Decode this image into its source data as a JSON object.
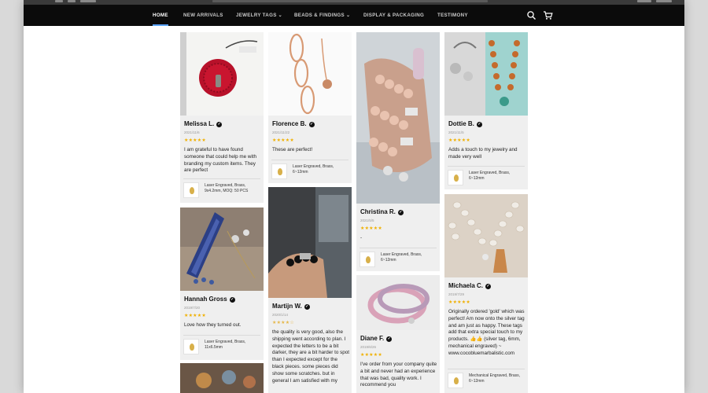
{
  "nav": {
    "items": [
      {
        "label": "HOME",
        "active": true
      },
      {
        "label": "NEW ARRIVALS",
        "active": false
      },
      {
        "label": "JEWELRY TAGS",
        "active": false,
        "dropdown": true
      },
      {
        "label": "BEADS & FINDINGS",
        "active": false,
        "dropdown": true
      },
      {
        "label": "DISPLAY & PACKAGING",
        "active": false
      },
      {
        "label": "TESTIMONY",
        "active": false
      }
    ],
    "search_icon": "search-icon",
    "cart_icon": "cart-icon",
    "dropdown_glyph": "⌄"
  },
  "reviews": {
    "verified_glyph": "✓",
    "star_full": "★★★★★",
    "star_partial": "★★★★☆",
    "cards": [
      {
        "id": "melissa",
        "name": "Melissa L.",
        "date": "2021/11/6",
        "rating": 5,
        "text": "I am grateful to have found someone that could help me with branding my custom items. They are perfect",
        "product": "Laser Engraved, Brass, 9x4.2mm, MOQ: 50 PCS"
      },
      {
        "id": "florence",
        "name": "Florence B.",
        "date": "2021/11/22",
        "rating": 5,
        "text": "These are perfect!",
        "product": "Laser Engraved, Brass, 6~12mm"
      },
      {
        "id": "christina",
        "name": "Christina R.",
        "date": "2021/5/5",
        "rating": 5,
        "text": "-",
        "product": "Laser Engraved, Brass, 6~12mm"
      },
      {
        "id": "dottie",
        "name": "Dottie B.",
        "date": "2021/11/5",
        "rating": 5,
        "text": "Adds a touch to my jewelry and made very well",
        "product": "Laser Engraved, Brass, 6~12mm"
      },
      {
        "id": "hannah",
        "name": "Hannah Gross",
        "date": "2019/7/20",
        "rating": 5,
        "text": "Love how they turned out.",
        "product": "Laser Engraved, Brass, 11x6.5mm"
      },
      {
        "id": "martijn",
        "name": "Martijn W.",
        "date": "2020/1/14",
        "rating": 4,
        "text": "the quality is very good, also the shipping went according to plan. I expected the letters to be a bit darker, they are a bit harder to spot than I expected except for the black pieces. some pieces did show some scratches. but in general I am satisfied with my",
        "product": ""
      },
      {
        "id": "diane",
        "name": "Diane F.",
        "date": "2019/6/26",
        "rating": 5,
        "text": "I've order from your company quite a bit and never had an experience that was bad, quality work. I recommend you",
        "product": ""
      },
      {
        "id": "michaela",
        "name": "Michaela C.",
        "date": "2019/7/29",
        "rating": 5,
        "text": "Originally ordered 'gold' which was perfect! Am now onto the silver tag and am just as happy. These tags add that extra special touch to my products. 👍👍 (silver tag, 6mm, mechanical engraved) ~ www.cocobluemarbalistic.com",
        "product": "Mechanical Engraved, Brass, 6~12mm"
      },
      {
        "id": "extra",
        "name": "",
        "date": "",
        "rating": 0,
        "text": "",
        "product": ""
      }
    ]
  },
  "colors": {
    "nav_bg": "#0b0b0b",
    "nav_active_underline": "#5aa3ff",
    "card_bg": "#efefef",
    "star": "#f0b000"
  }
}
